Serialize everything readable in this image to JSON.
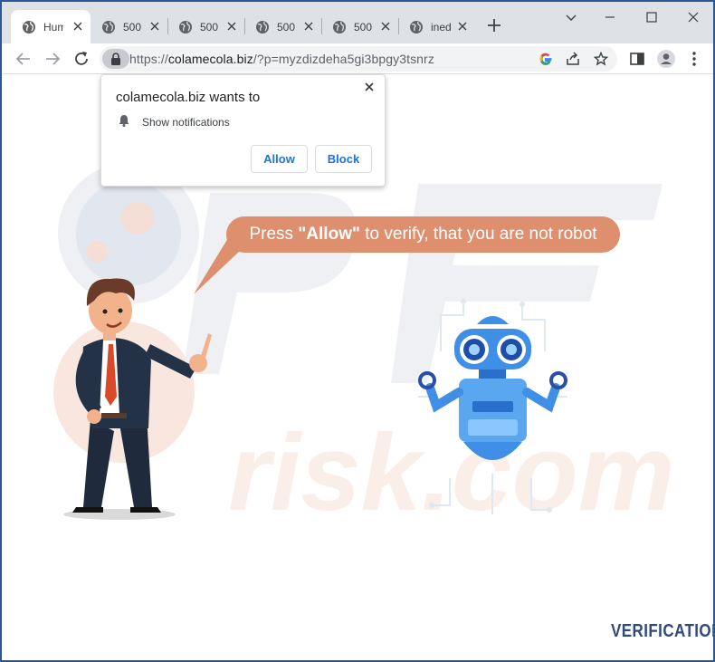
{
  "tabs": [
    {
      "title": "Hum",
      "active": true
    },
    {
      "title": "500",
      "active": false
    },
    {
      "title": "500",
      "active": false
    },
    {
      "title": "500",
      "active": false
    },
    {
      "title": "500",
      "active": false
    },
    {
      "title": "ined",
      "active": false
    }
  ],
  "address_bar": {
    "scheme": "https://",
    "host": "colamecola.biz",
    "path": "/?p=myzdizdeha5gi3bpgy3tsnrz"
  },
  "permission_prompt": {
    "title": "colamecola.biz wants to",
    "permission": "Show notifications",
    "allow_label": "Allow",
    "block_label": "Block"
  },
  "page": {
    "bubble_prefix": "Press ",
    "bubble_emphasis": "\"Allow\"",
    "bubble_suffix": " to verify, that you are not robot",
    "verification_label": "VERIFICATION"
  },
  "colors": {
    "window_border": "#2b5797",
    "tabstrip_bg": "#dee1e6",
    "bubble_bg": "#de8f6e",
    "verification_text": "#2f4b7c",
    "button_text": "#1a73e8"
  },
  "icons": [
    "globe-icon",
    "close-icon",
    "plus-icon",
    "minimize-icon",
    "maximize-icon",
    "window-close-icon",
    "back-arrow-icon",
    "forward-arrow-icon",
    "reload-icon",
    "lock-icon",
    "google-icon",
    "share-icon",
    "star-icon",
    "side-panel-icon",
    "profile-icon",
    "kebab-menu-icon",
    "bell-icon"
  ]
}
